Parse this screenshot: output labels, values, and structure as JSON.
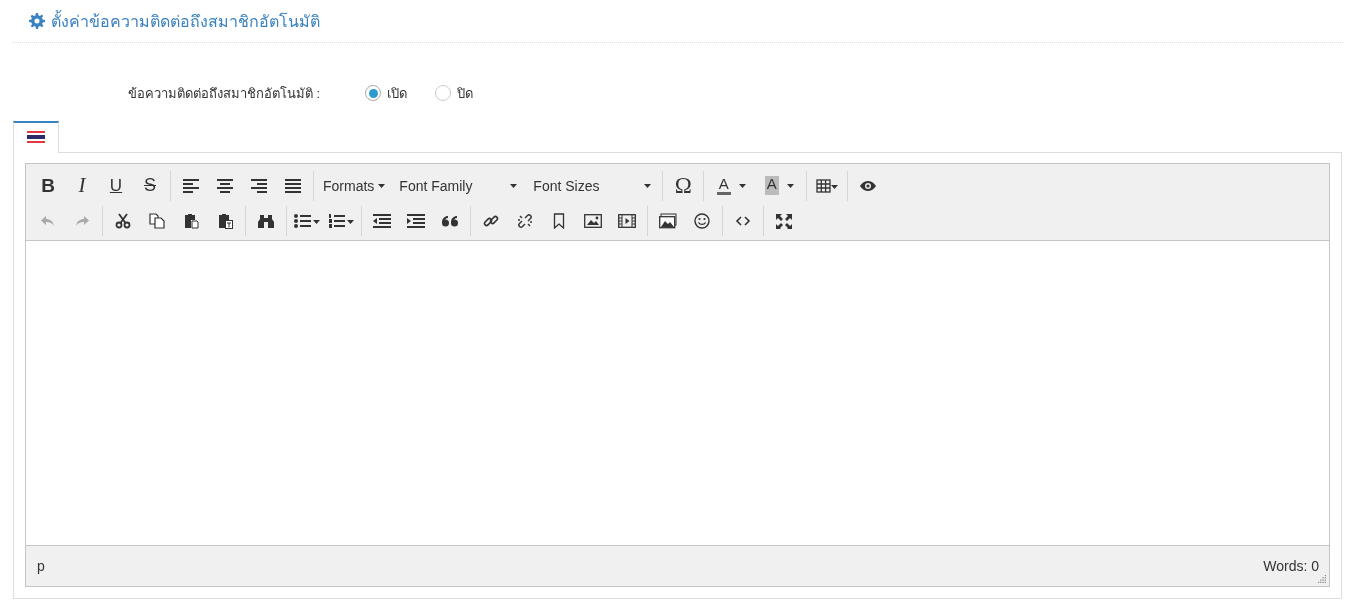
{
  "header": {
    "title": "ตั้งค่าข้อความติดต่อถึงสมาชิกอัตโนมัติ"
  },
  "setting": {
    "label": "ข้อความติดต่อถึงสมาชิกอัตโนมัติ :",
    "options": [
      {
        "label": "เปิด",
        "selected": true
      },
      {
        "label": "ปิด",
        "selected": false
      }
    ]
  },
  "language_tabs": [
    {
      "selected": true
    }
  ],
  "toolbar": {
    "rows": [
      [
        [
          {
            "kind": "bold",
            "label": "B"
          },
          {
            "kind": "italic",
            "label": "I"
          },
          {
            "kind": "underline",
            "label": "U"
          },
          {
            "kind": "strike",
            "label": "S"
          }
        ],
        [
          {
            "kind": "align-left"
          },
          {
            "kind": "align-center"
          },
          {
            "kind": "align-right"
          },
          {
            "kind": "justify"
          }
        ],
        [
          {
            "kind": "menu",
            "label": "Formats"
          },
          {
            "kind": "select",
            "label": "Font Family"
          },
          {
            "kind": "select",
            "label": "Font Sizes"
          }
        ],
        [
          {
            "kind": "symbol",
            "label": "Ω"
          }
        ],
        [
          {
            "kind": "text-color",
            "label": "A"
          },
          {
            "kind": "background-color",
            "label": "A"
          }
        ],
        [
          {
            "kind": "table"
          }
        ],
        [
          {
            "kind": "preview"
          }
        ]
      ],
      [
        [
          {
            "kind": "undo",
            "disabled": true
          },
          {
            "kind": "redo",
            "disabled": true
          }
        ],
        [
          {
            "kind": "cut"
          },
          {
            "kind": "copy"
          },
          {
            "kind": "paste"
          },
          {
            "kind": "paste-text"
          }
        ],
        [
          {
            "kind": "find"
          }
        ],
        [
          {
            "kind": "bullet-list"
          },
          {
            "kind": "number-list"
          }
        ],
        [
          {
            "kind": "outdent"
          },
          {
            "kind": "indent"
          },
          {
            "kind": "blockquote"
          }
        ],
        [
          {
            "kind": "link"
          },
          {
            "kind": "unlink"
          },
          {
            "kind": "bookmark"
          },
          {
            "kind": "image"
          },
          {
            "kind": "media"
          }
        ],
        [
          {
            "kind": "gallery"
          },
          {
            "kind": "emoticon"
          }
        ],
        [
          {
            "kind": "code"
          }
        ],
        [
          {
            "kind": "fullscreen"
          }
        ]
      ]
    ]
  },
  "status_bar": {
    "path": "p",
    "word_count": "Words: 0"
  }
}
